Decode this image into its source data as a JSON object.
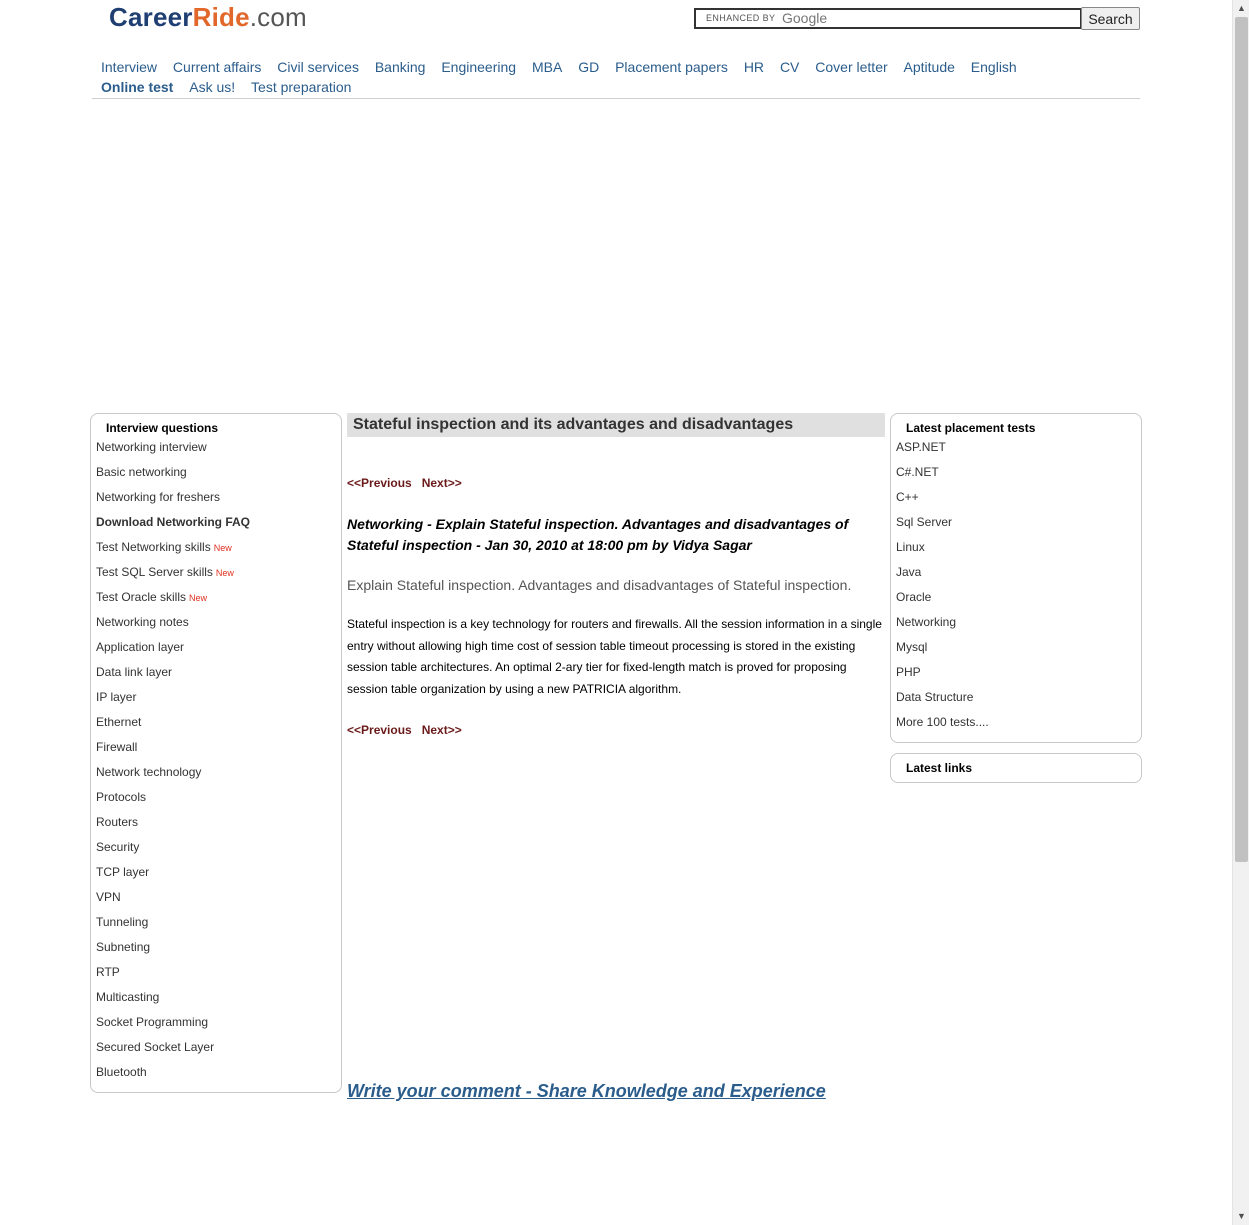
{
  "header": {
    "logo": {
      "part1": "Career",
      "part2": "Ride",
      "part3": ".com"
    },
    "search": {
      "enhanced_label": "ENHANCED BY",
      "google_label": "Google",
      "button": "Search"
    }
  },
  "nav": [
    "Interview",
    "Current affairs",
    "Civil services",
    "Banking",
    "Engineering",
    "MBA",
    "GD",
    "Placement papers",
    "HR",
    "CV",
    "Cover letter",
    "Aptitude",
    "English",
    "Online test",
    "Ask us!",
    "Test preparation"
  ],
  "left_sidebar": {
    "title": "Interview questions",
    "items": [
      {
        "label": "Networking interview"
      },
      {
        "label": "Basic networking"
      },
      {
        "label": "Networking for freshers"
      },
      {
        "label": "Download Networking FAQ"
      },
      {
        "label": "Test Networking skills",
        "badge": "New"
      },
      {
        "label": "Test SQL Server skills",
        "badge": "New"
      },
      {
        "label": "Test Oracle skills",
        "badge": "New"
      },
      {
        "label": "Networking notes"
      },
      {
        "label": "Application layer"
      },
      {
        "label": "Data link layer"
      },
      {
        "label": "IP layer"
      },
      {
        "label": "Ethernet"
      },
      {
        "label": "Firewall"
      },
      {
        "label": "Network technology"
      },
      {
        "label": "Protocols"
      },
      {
        "label": "Routers"
      },
      {
        "label": "Security"
      },
      {
        "label": "TCP layer"
      },
      {
        "label": "VPN"
      },
      {
        "label": "Tunneling"
      },
      {
        "label": "Subneting"
      },
      {
        "label": "RTP"
      },
      {
        "label": "Multicasting"
      },
      {
        "label": "Socket Programming"
      },
      {
        "label": "Secured Socket Layer"
      },
      {
        "label": "Bluetooth"
      }
    ]
  },
  "article": {
    "title": "Stateful inspection and its advantages and disadvantages",
    "prev": "<<Previous",
    "next": "Next>>",
    "byline": "Networking - Explain Stateful inspection. Advantages and disadvantages of Stateful inspection - Jan 30, 2010 at 18:00 pm by Vidya Sagar",
    "question": "Explain Stateful inspection. Advantages and disadvantages of Stateful inspection.",
    "answer": "Stateful inspection is a key technology for routers and firewalls. All the session information in a single entry without allowing high time cost of session table timeout processing is stored in the existing session table architectures. An optimal 2-ary tier for fixed-length match is proved for proposing session table organization by using a new PATRICIA algorithm.",
    "comment_link": "Write your comment - Share Knowledge and Experience"
  },
  "right_sidebar": {
    "title": "Latest placement tests",
    "items": [
      "ASP.NET",
      "C#.NET",
      "C++",
      "Sql Server",
      "Linux",
      "Java",
      "Oracle",
      "Networking",
      "Mysql",
      "PHP",
      "Data Structure",
      "More 100 tests...."
    ]
  },
  "latest_links": {
    "title": "Latest links"
  },
  "scrollbar": {
    "up_icon": "▲",
    "down_icon": "▼"
  }
}
